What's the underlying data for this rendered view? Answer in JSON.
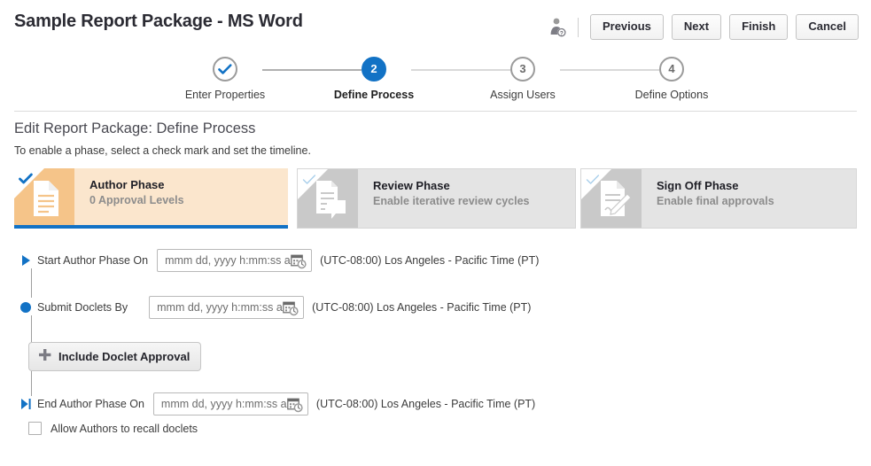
{
  "header": {
    "title": "Sample Report Package - MS Word",
    "user_icon": "user-question-icon",
    "buttons": [
      {
        "label": "Previous",
        "name": "previous-button"
      },
      {
        "label": "Next",
        "name": "next-button"
      },
      {
        "label": "Finish",
        "name": "finish-button"
      },
      {
        "label": "Cancel",
        "name": "cancel-button"
      }
    ]
  },
  "stepper": {
    "steps": [
      {
        "number": "1",
        "label": "Enter Properties",
        "state": "done"
      },
      {
        "number": "2",
        "label": "Define Process",
        "state": "active"
      },
      {
        "number": "3",
        "label": "Assign Users",
        "state": "todo"
      },
      {
        "number": "4",
        "label": "Define Options",
        "state": "todo"
      }
    ],
    "active_color": "#1272c5"
  },
  "section": {
    "title": "Edit Report Package: Define Process",
    "subtitle": "To enable a phase, select a check mark and set the timeline."
  },
  "phases": [
    {
      "name": "author",
      "title": "Author Phase",
      "subtitle": "0 Approval Levels",
      "enabled": true,
      "icon": "document-icon",
      "accent": "#f5c489",
      "body_color": "#fbe6cd",
      "underline_color": "#1272c5"
    },
    {
      "name": "review",
      "title": "Review Phase",
      "subtitle": "Enable iterative review cycles",
      "enabled": false,
      "icon": "document-comment-icon",
      "accent": "#c9c9c9",
      "body_color": "#e4e4e4"
    },
    {
      "name": "signoff",
      "title": "Sign Off Phase",
      "subtitle": "Enable final approvals",
      "enabled": false,
      "icon": "document-signature-icon",
      "accent": "#c9c9c9",
      "body_color": "#e4e4e4"
    }
  ],
  "timeline": {
    "rows": [
      {
        "name": "start-author-phase",
        "label": "Start Author Phase On",
        "marker": "play-triangle-icon",
        "date_value": "",
        "date_placeholder": "mmm dd, yyyy h:mm:ss a z",
        "timezone": "(UTC-08:00) Los Angeles - Pacific Time (PT)"
      },
      {
        "name": "submit-doclets-by",
        "label": "Submit Doclets By",
        "marker": "filled-circle-icon",
        "date_value": "",
        "date_placeholder": "mmm dd, yyyy h:mm:ss a z",
        "timezone": "(UTC-08:00) Los Angeles - Pacific Time (PT)"
      },
      {
        "name": "end-author-phase",
        "label": "End Author Phase On",
        "marker": "end-triangle-bar-icon",
        "date_value": "",
        "date_placeholder": "mmm dd, yyyy h:mm:ss a z",
        "timezone": "(UTC-08:00) Los Angeles - Pacific Time (PT)"
      }
    ],
    "include_approval_button": "Include Doclet Approval",
    "recall_checkbox_label": "Allow Authors to recall doclets",
    "recall_checked": false
  }
}
